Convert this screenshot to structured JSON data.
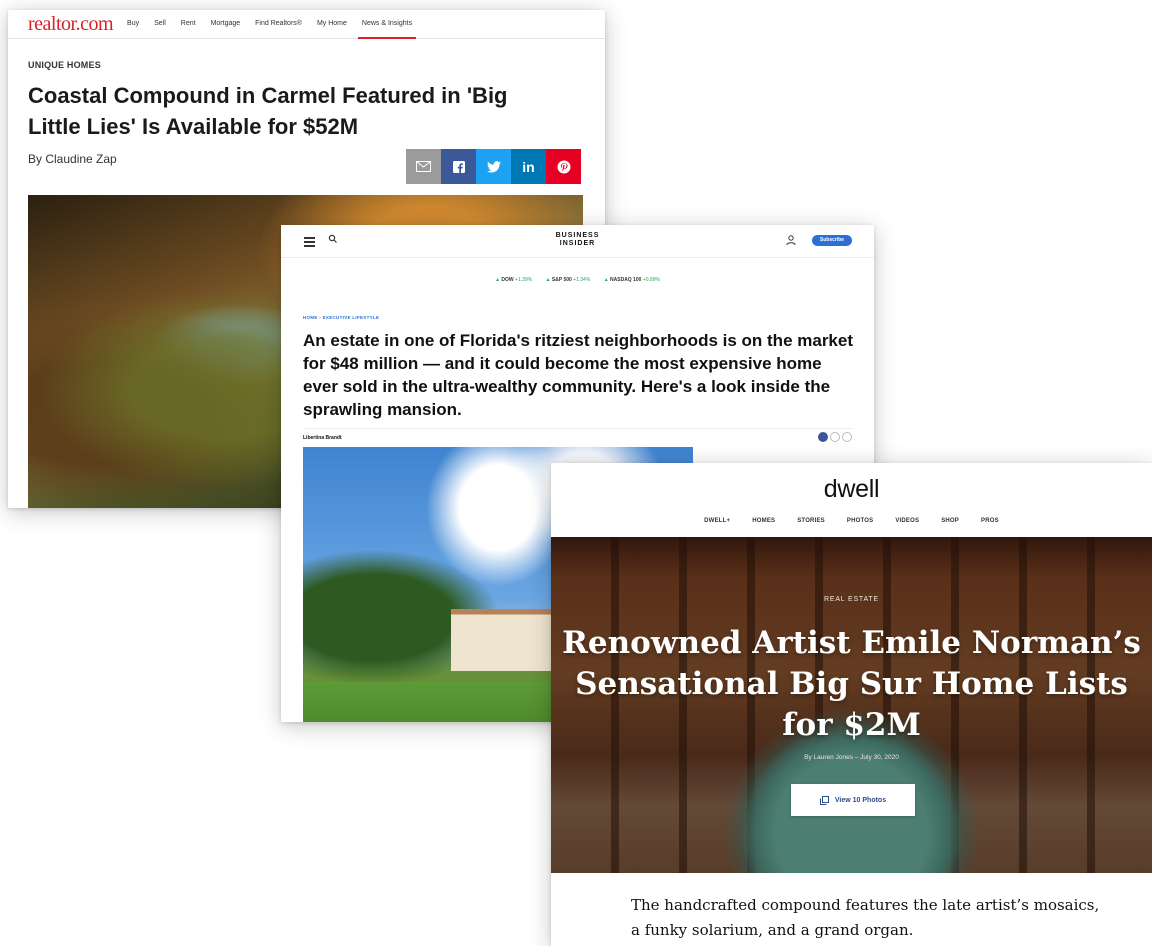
{
  "realtor": {
    "logo": "realtor.com",
    "nav": [
      "Buy",
      "Sell",
      "Rent",
      "Mortgage",
      "Find Realtors®",
      "My Home",
      "News & Insights"
    ],
    "active_nav": "News & Insights",
    "kicker": "UNIQUE HOMES",
    "headline": "Coastal Compound in Carmel Featured in 'Big Little Lies' Is Available for $52M",
    "byline": "By Claudine Zap",
    "share": [
      {
        "icon": "email-icon",
        "color": "#9b9b9b",
        "glyph": "✉"
      },
      {
        "icon": "facebook-icon",
        "color": "#3b5998",
        "glyph": "f"
      },
      {
        "icon": "twitter-icon",
        "color": "#1da1f2",
        "glyph": "🐦"
      },
      {
        "icon": "linkedin-icon",
        "color": "#0077b5",
        "glyph": "in"
      },
      {
        "icon": "pinterest-icon",
        "color": "#e60023",
        "glyph": "℗"
      }
    ],
    "accent": "#d92228"
  },
  "business_insider": {
    "brand_line1": "BUSINESS",
    "brand_line2": "INSIDER",
    "subscribe": "Subscribe",
    "ticker": [
      {
        "name": "DOW",
        "change": "+1.39%"
      },
      {
        "name": "S&P 500",
        "change": "+1.34%"
      },
      {
        "name": "NASDAQ 100",
        "change": "+0.99%"
      }
    ],
    "breadcrumb": "HOME › EXECUTIVE LIFESTYLE",
    "headline": "An estate in one of Florida's ritziest neighborhoods is on the market for $48 million — and it could become the most expensive home ever sold in the ultra-wealthy community. Here's a look inside the sprawling mansion.",
    "author": "Libertina Brandt",
    "accent": "#2d6fd8"
  },
  "dwell": {
    "logo": "dwell",
    "nav": [
      "DWELL+",
      "HOMES",
      "STORIES",
      "PHOTOS",
      "VIDEOS",
      "SHOP",
      "PROS"
    ],
    "category": "REAL ESTATE",
    "title": "Renowned Artist Emile Norman’s Sensational Big Sur Home Lists for $2M",
    "byline": "By Lauren Jones – July 30, 2020",
    "button": "View 10 Photos",
    "dek": "The handcrafted compound features the late artist’s mosaics, a funky solarium, and a grand organ."
  }
}
